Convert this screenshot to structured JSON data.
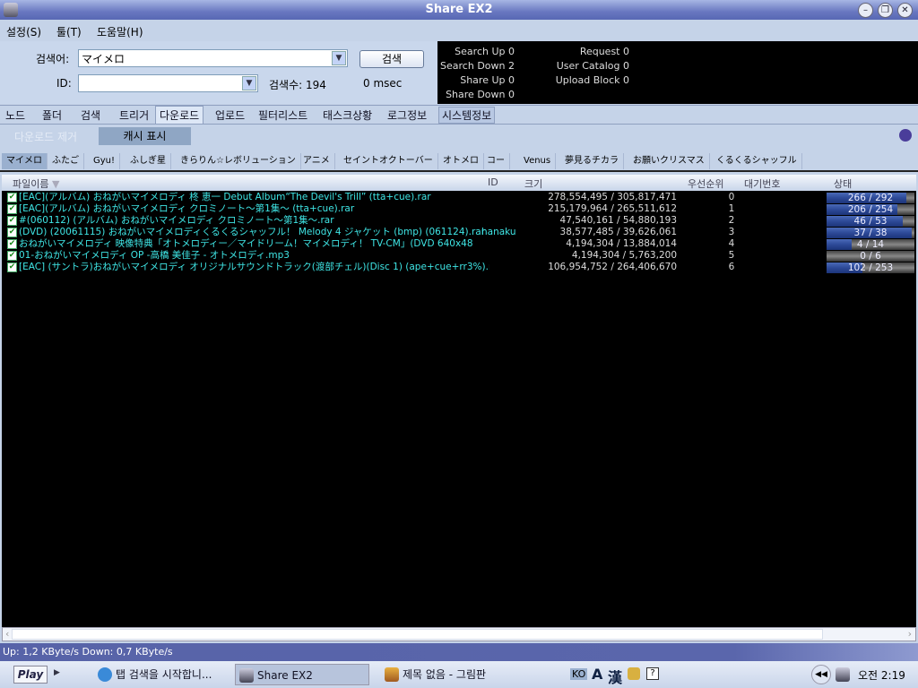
{
  "window": {
    "title": "Share EX2"
  },
  "menu": [
    "설정(S)",
    "툴(T)",
    "도움말(H)"
  ],
  "search": {
    "keyword_label": "검색어:",
    "keyword_value": "マイメロ",
    "id_label": "ID:",
    "id_value": "",
    "search_button": "검색",
    "count_text": "검색수: 194",
    "time_text": "0 msec"
  },
  "stats": {
    "left": [
      {
        "label": "Search Up",
        "value": "0"
      },
      {
        "label": "Search Down",
        "value": "2"
      },
      {
        "label": "Share Up",
        "value": "0"
      },
      {
        "label": "Share Down",
        "value": "0"
      }
    ],
    "right": [
      {
        "label": "Request",
        "value": "0"
      },
      {
        "label": "User Catalog",
        "value": "0"
      },
      {
        "label": "Upload Block",
        "value": "0"
      }
    ]
  },
  "tabs": [
    "노드",
    "폴더",
    "검색",
    "트리거",
    "다운로드",
    "업로드",
    "필터리스트",
    "태스크상황",
    "로그정보",
    "시스템정보"
  ],
  "active_tab": "다운로드",
  "toolbar": {
    "remove_download": "다운로드 제거",
    "show_cache": "캐시 표시"
  },
  "tags": [
    "マイメロ",
    "ふたご",
    "Gyu!",
    "ふしぎ星",
    "きらりん☆レボリューション",
    "アニメ",
    "セイントオクトーバー",
    "オトメロ",
    "コー",
    "Venus",
    "夢見るチカラ",
    "お願いクリスマス",
    "くるくるシャッフル"
  ],
  "columns": {
    "filename": "파일이름",
    "id": "ID",
    "size": "크기",
    "priority": "우선순위",
    "queue": "대기번호",
    "status": "상태"
  },
  "rows": [
    {
      "name": "[EAC](アルバム) おねがいマイメロディ 柊 恵一 Debut Album“The Devil's Trill” (tta+cue).rar",
      "id": "",
      "size": "278,554,495 / 305,817,471",
      "priority": "0",
      "status": "266 / 292",
      "done": 266,
      "total": 292
    },
    {
      "name": "[EAC](アルバム) おねがいマイメロディ クロミノート～第1集～ (tta+cue).rar",
      "id": "",
      "size": "215,179,964 / 265,511,612",
      "priority": "1",
      "status": "206 / 254",
      "done": 206,
      "total": 254
    },
    {
      "name": "#(060112) (アルバム) おねがいマイメロディ クロミノート～第1集～.rar",
      "id": "",
      "size": "47,540,161 / 54,880,193",
      "priority": "2",
      "status": "46 / 53",
      "done": 46,
      "total": 53
    },
    {
      "name": "(DVD) (20061115) おねがいマイメロディくるくるシャッフル！ Melody 4 ジャケット (bmp) (061124).rar",
      "id": "hanaku",
      "size": "38,577,485 / 39,626,061",
      "priority": "3",
      "status": "37 / 38",
      "done": 37,
      "total": 38
    },
    {
      "name": "おねがいマイメロディ 映像特典「オトメロディー／マイドリーム！マイメロディ！ TV-CM」(DVD 640x48",
      "id": "",
      "size": "4,194,304 / 13,884,014",
      "priority": "4",
      "status": "4 / 14",
      "done": 4,
      "total": 14
    },
    {
      "name": "01-おねがいマイメロディ OP -高橋 美佳子 - オトメロディ.mp3",
      "id": "",
      "size": "4,194,304 / 5,763,200",
      "priority": "5",
      "status": "0 / 6",
      "done": 0,
      "total": 6
    },
    {
      "name": "[EAC] (サントラ)おねがいマイメロディ オリジナルサウンドトラック(渡部チェル)(Disc 1) (ape+cue+rr3%).rar",
      "id": "",
      "size": "106,954,752 / 264,406,670",
      "priority": "6",
      "status": "102 / 253",
      "done": 102,
      "total": 253
    }
  ],
  "statusbar": "Up: 1,2 KByte/s Down: 0,7 KByte/s",
  "taskbar": {
    "play": "Play",
    "tasks": [
      "탭 검색을 시작합니...",
      "Share EX2",
      "제목 없음 - 그림판"
    ],
    "ime": [
      "KO",
      "A",
      "漢"
    ],
    "clock": "오전 2:19"
  }
}
